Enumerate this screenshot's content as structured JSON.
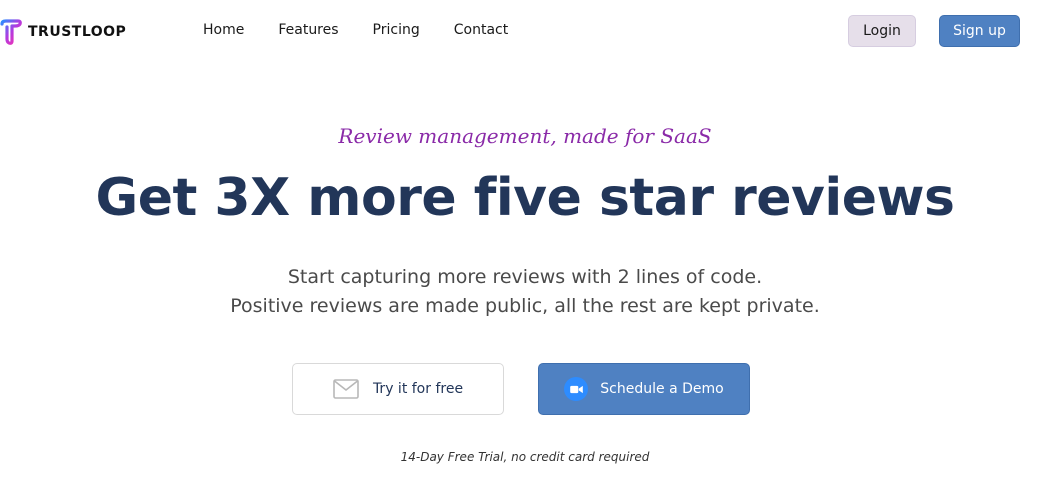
{
  "header": {
    "brand": "TRUSTLOOP",
    "nav": [
      "Home",
      "Features",
      "Pricing",
      "Contact"
    ],
    "login_label": "Login",
    "signup_label": "Sign up"
  },
  "hero": {
    "tagline": "Review management, made for SaaS",
    "headline": "Get 3X more five star reviews",
    "subline_1": "Start capturing more reviews with 2 lines of code.",
    "subline_2": "Positive reviews are made public, all the rest are kept private.",
    "try_label": "Try it for free",
    "try_icon": "mail-icon",
    "demo_label": "Schedule a Demo",
    "demo_icon": "video-camera-icon",
    "note": "14-Day Free Trial, no credit card required"
  },
  "colors": {
    "accent_blue": "#4f81c2",
    "headline_navy": "#223659",
    "tagline_purple": "#8a2aa8",
    "login_bg": "#e6dfea"
  }
}
